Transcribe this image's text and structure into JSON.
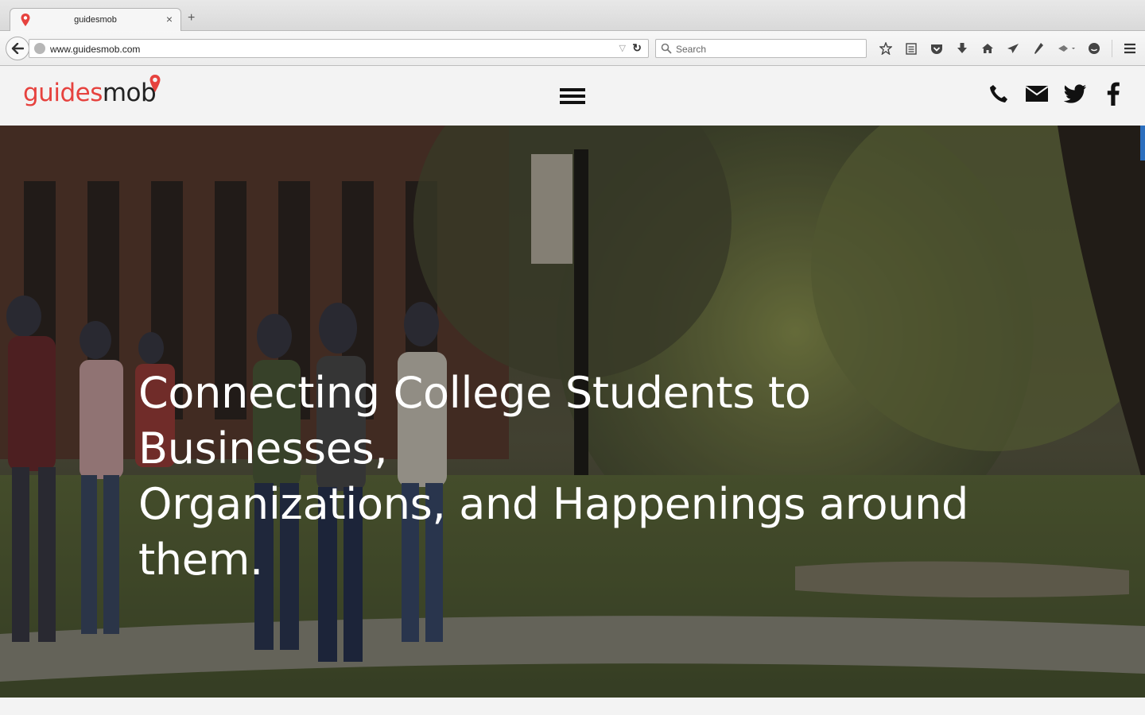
{
  "browser": {
    "tab": {
      "title": "guidesmob",
      "favicon": "map-pin-icon",
      "close_glyph": "×"
    },
    "new_tab_glyph": "+",
    "url": "www.guidesmob.com",
    "search": {
      "placeholder": "Search"
    },
    "toolbar_icons": [
      "star-icon",
      "reading-list-icon",
      "pocket-icon",
      "download-icon",
      "home-icon",
      "send-icon",
      "pen-icon",
      "extension-icon",
      "chat-icon",
      "menu-icon"
    ]
  },
  "site": {
    "logo": {
      "part1": "guides",
      "part2": "mob",
      "color_primary": "#e6423e",
      "color_secondary": "#222222"
    },
    "social": [
      "phone-icon",
      "mail-icon",
      "twitter-icon",
      "facebook-icon"
    ],
    "hero": {
      "line1": "Connecting College Students to Businesses,",
      "line2": "Organizations, and Happenings around them."
    }
  },
  "colors": {
    "accent_blue": "#2c6fbe",
    "header_bg": "#f3f3f3"
  }
}
